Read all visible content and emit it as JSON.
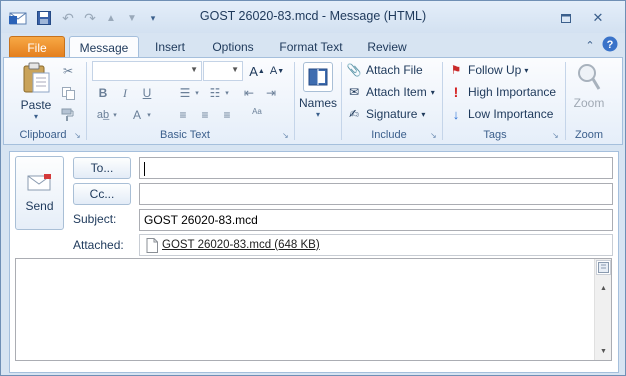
{
  "window": {
    "title": "GOST 26020-83.mcd - Message (HTML)"
  },
  "tabs": [
    {
      "label": "File"
    },
    {
      "label": "Message"
    },
    {
      "label": "Insert"
    },
    {
      "label": "Options"
    },
    {
      "label": "Format Text"
    },
    {
      "label": "Review"
    }
  ],
  "ribbon": {
    "clipboard": {
      "paste_label": "Paste",
      "group_label": "Clipboard"
    },
    "basic_text": {
      "group_label": "Basic Text"
    },
    "names": {
      "label": "Names"
    },
    "include": {
      "attach_file": "Attach File",
      "attach_item": "Attach Item",
      "signature": "Signature",
      "group_label": "Include"
    },
    "tags": {
      "follow_up": "Follow Up",
      "high_importance": "High Importance",
      "low_importance": "Low Importance",
      "group_label": "Tags"
    },
    "zoom": {
      "label": "Zoom",
      "group_label": "Zoom"
    }
  },
  "compose": {
    "send_label": "Send",
    "to_button": "To...",
    "cc_button": "Cc...",
    "to_value": "",
    "cc_value": "",
    "subject_label": "Subject:",
    "subject_value": "GOST 26020-83.mcd",
    "attached_label": "Attached:",
    "attachment": "GOST 26020-83.mcd (648 KB)",
    "body_value": ""
  },
  "colors": {
    "file_tab": "#e37d1c",
    "ribbon_bg": "#e5eef9",
    "accent_text": "#1e395b",
    "high_importance": "#d42020",
    "low_importance": "#2a6fd6"
  }
}
